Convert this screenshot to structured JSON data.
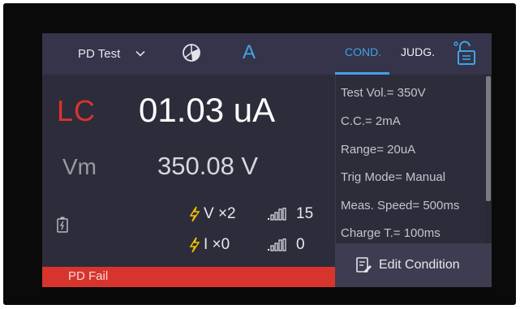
{
  "topbar": {
    "mode_label": "PD Test",
    "auto_label": "A",
    "tabs": [
      {
        "label": "COND.",
        "active": true
      },
      {
        "label": "JUDG.",
        "active": false
      }
    ]
  },
  "measure": {
    "lc_label": "LC",
    "lc_value": "01.03 uA",
    "vm_label": "Vm",
    "vm_value": "350.08 V"
  },
  "stats": {
    "v_count": "V ×2",
    "i_count": "I ×0",
    "v_signal": "15",
    "i_signal": "0"
  },
  "status": {
    "text": "PD Fail",
    "color": "#d8342e"
  },
  "conditions": [
    "Test Vol.= 350V",
    "C.C.= 2mA",
    "Range= 20uA",
    "Trig Mode= Manual",
    "Meas. Speed= 500ms",
    "Charge T.= 100ms"
  ],
  "edit_button": {
    "label": "Edit Condition"
  },
  "colors": {
    "accent": "#3ea4e6",
    "alert": "#d8342e",
    "bolt": "#f2c400",
    "background": "#2d2c3b"
  }
}
